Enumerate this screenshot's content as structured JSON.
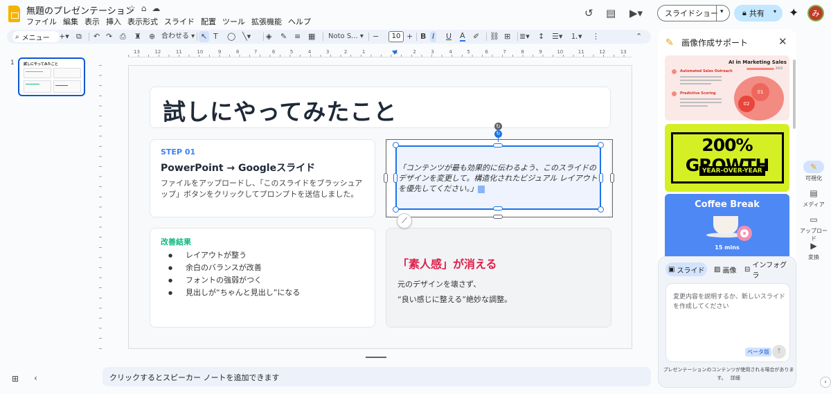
{
  "header": {
    "title": "無題のプレゼンテーション",
    "menus": [
      "ファイル",
      "編集",
      "表示",
      "挿入",
      "表示形式",
      "スライド",
      "配置",
      "ツール",
      "拡張機能",
      "ヘルプ"
    ],
    "slideshow_label": "スライドショー",
    "share_label": "共有",
    "avatar_letter": "み"
  },
  "toolbar": {
    "menu_label": "メニュー",
    "fit_label": "合わせる",
    "font_name": "Noto S...",
    "font_size": "10"
  },
  "ruler": {
    "numbers": [
      "13",
      "12",
      "11",
      "10",
      "9",
      "8",
      "7",
      "6",
      "5",
      "4",
      "3",
      "2",
      "1",
      "",
      "1",
      "2",
      "3",
      "4",
      "5",
      "6",
      "7",
      "8",
      "9",
      "10",
      "11",
      "12",
      "13"
    ]
  },
  "filmstrip": {
    "slide_number": "1",
    "thumb_title": "試しにやってみたこと"
  },
  "slide": {
    "title": "試しにやってみたこと",
    "step_label": "STEP 01",
    "step_heading": "PowerPoint → Googleスライド",
    "step_body": "ファイルをアップロードし、「このスライドをブラッシュアップ」ボタンをクリックしてプロンプトを送信しました。",
    "prompt_text": "「コンテンツが最も効果的に伝わるよう、このスライドのデザインを変更して。構造化されたビジュアル レイアウトを優先してください。」",
    "results_title": "改善結果",
    "results": [
      "レイアウトが整う",
      "余白のバランスが改善",
      "フォントの強弱がつく",
      "見出しが“ちゃんと見出し”になる"
    ],
    "effect_heading": "「素人感」が消える",
    "effect_line1": "元のデザインを壊さず、",
    "effect_line2": "“良い感じに整える”絶妙な調整。"
  },
  "notes": {
    "placeholder": "クリックするとスピーカー ノートを追加できます"
  },
  "side_panel": {
    "title": "画像作成サポート",
    "cards": [
      {
        "title": "AI in Marketing Sales",
        "year": "2025",
        "bullet1": "Automated Sales Outreach",
        "bullet2": "Predictive Scoring",
        "num1": "01",
        "num2": "02"
      },
      {
        "big": "200% GROWTH",
        "small": "YEAR-OVER-YEAR"
      },
      {
        "title": "Coffee Break",
        "subtitle": "15 mins"
      }
    ],
    "tabs": [
      "スライド",
      "画像",
      "インフォグラ"
    ],
    "compose_placeholder": "変更内容を説明するか、新しいスライドを作成してください",
    "beta_label": "ベータ版",
    "disclaimer": "プレゼンテーションのコンテンツが使用される場合があります。",
    "disclaimer_link": "詳細"
  },
  "right_rail": [
    {
      "label": "可視化",
      "icon": "visualize-icon"
    },
    {
      "label": "メディア",
      "icon": "media-icon"
    },
    {
      "label": "アップロード",
      "icon": "folder-icon"
    },
    {
      "label": "変換",
      "icon": "convert-icon"
    }
  ],
  "colors": {
    "accent_blue": "#1a73e8",
    "step_blue": "#3b82f6",
    "results_green": "#10b981",
    "effect_red": "#e11d48",
    "share_bg": "#c2e7ff"
  }
}
